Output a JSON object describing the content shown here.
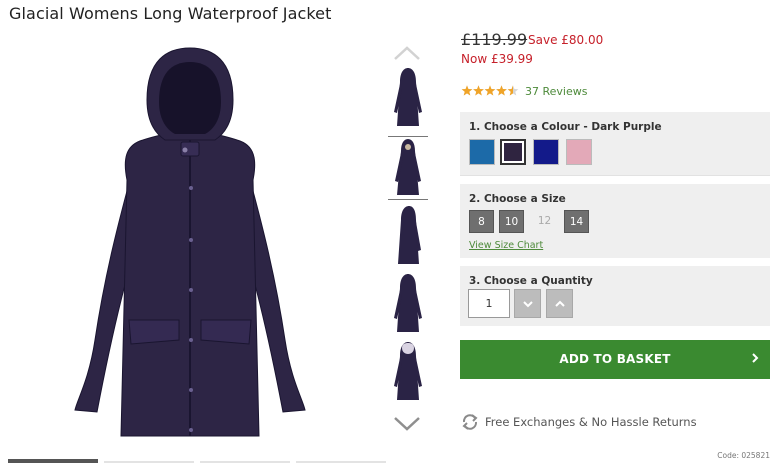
{
  "product": {
    "title": "Glacial Womens Long Waterproof Jacket",
    "code": "Code: 025821",
    "image_colour": "#2a2345"
  },
  "price": {
    "was": "£119.99",
    "save": "Save £80.00",
    "now": "Now £39.99"
  },
  "rating": {
    "stars": 4.5,
    "reviews": "37 Reviews",
    "star_color": "#f0a428"
  },
  "colour": {
    "heading": "1. Choose a Colour - Dark Purple",
    "swatches": [
      {
        "name": "blue",
        "color": "#1c6aa8",
        "selected": false
      },
      {
        "name": "dark purple",
        "color": "#2f2440",
        "selected": true
      },
      {
        "name": "navy",
        "color": "#131a8a",
        "selected": false
      },
      {
        "name": "pink",
        "color": "#e3a9b8",
        "selected": false
      }
    ]
  },
  "size": {
    "heading": "2. Choose a Size",
    "options": [
      {
        "label": "8",
        "available": true
      },
      {
        "label": "10",
        "available": true
      },
      {
        "label": "12",
        "available": false
      },
      {
        "label": "14",
        "available": true
      }
    ],
    "chart_link": "View Size Chart"
  },
  "quantity": {
    "heading": "3. Choose a Quantity",
    "value": "1",
    "decrease_icon": "chevron-down-icon",
    "increase_icon": "chevron-up-icon"
  },
  "cta": {
    "label": "ADD TO BASKET",
    "color": "#3a8a30",
    "icon": "chevron-right-icon"
  },
  "returns": {
    "label": "Free Exchanges & No Hassle Returns",
    "icon": "refresh-icon"
  },
  "gallery": {
    "thumbnail_count": 5,
    "selected_index": 1,
    "up_icon": "chevron-up-icon",
    "down_icon": "chevron-down-icon"
  }
}
